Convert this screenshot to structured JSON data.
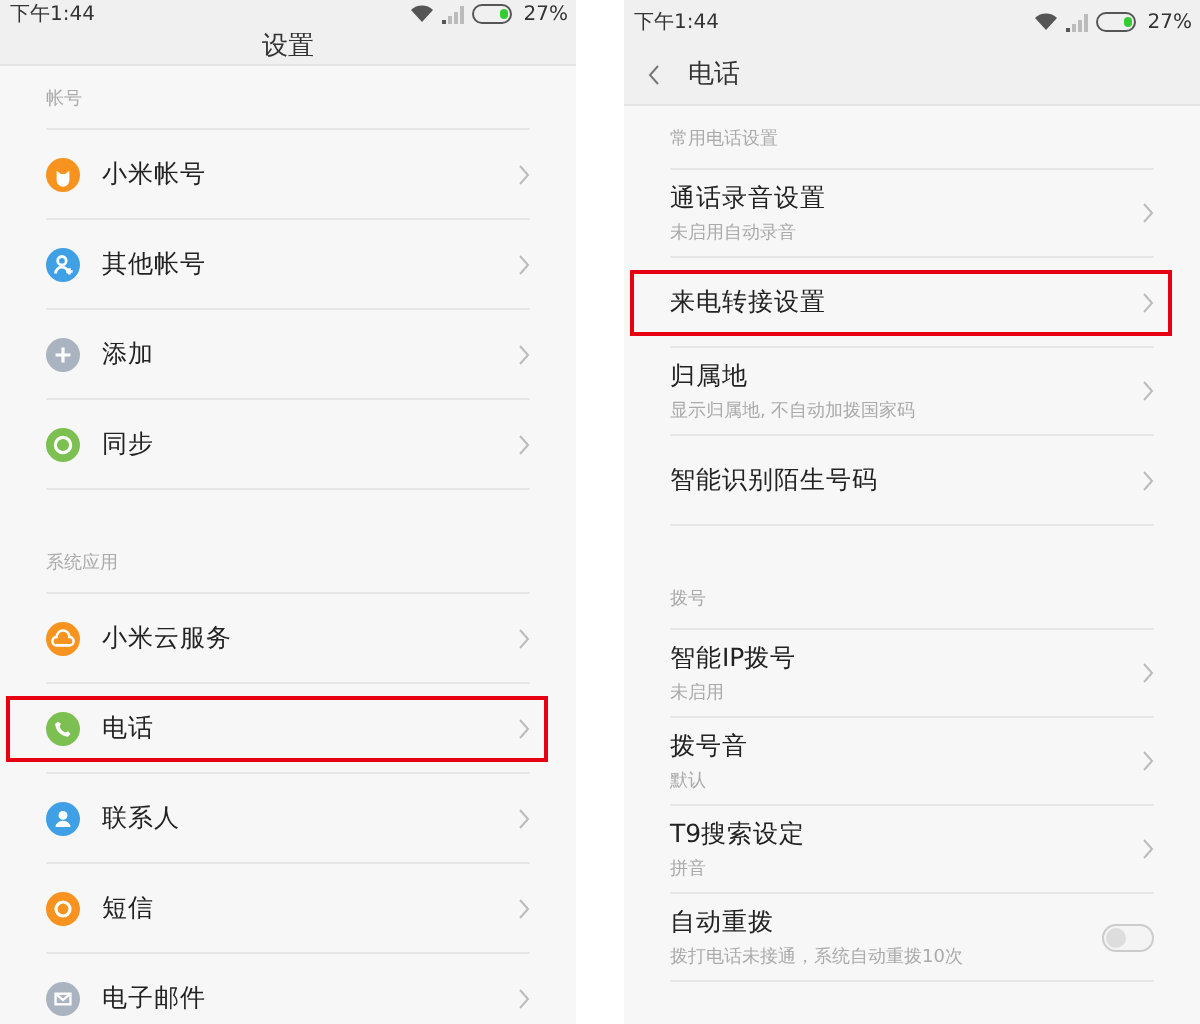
{
  "screens": [
    {
      "status_bar": {
        "time": "下午1:44",
        "battery": "27%"
      },
      "header": {
        "title": "设置",
        "back": false
      },
      "sections": [
        {
          "title": "帐号",
          "items": [
            {
              "label": "小米帐号",
              "kind": "mi",
              "color": "#f7931e",
              "highlighted": false
            },
            {
              "label": "其他帐号",
              "kind": "person",
              "color": "#3fa0e6",
              "highlighted": false
            },
            {
              "label": "添加",
              "kind": "plus",
              "color": "#a9b4c0",
              "highlighted": false
            },
            {
              "label": "同步",
              "kind": "sync",
              "color": "#7cc052",
              "highlighted": false
            }
          ]
        },
        {
          "title": "系统应用",
          "items": [
            {
              "label": "小米云服务",
              "kind": "cloud",
              "color": "#f7931e",
              "highlighted": false
            },
            {
              "label": "电话",
              "kind": "phone",
              "color": "#7cc052",
              "highlighted": true
            },
            {
              "label": "联系人",
              "kind": "contact",
              "color": "#3fa0e6",
              "highlighted": false
            },
            {
              "label": "短信",
              "kind": "message",
              "color": "#f7931e",
              "highlighted": false
            },
            {
              "label": "电子邮件",
              "kind": "mail",
              "color": "#a9b4c0",
              "highlighted": false
            }
          ]
        }
      ]
    },
    {
      "status_bar": {
        "time": "下午1:44",
        "battery": "27%"
      },
      "header": {
        "title": "电话",
        "back": true
      },
      "sections": [
        {
          "title": "常用电话设置",
          "items": [
            {
              "label": "通话录音设置",
              "subtitle": "未启用自动录音",
              "highlighted": false
            },
            {
              "label": "来电转接设置",
              "highlighted": true
            },
            {
              "label": "归属地",
              "subtitle": "显示归属地, 不自动加拨国家码",
              "highlighted": false
            },
            {
              "label": "智能识别陌生号码",
              "highlighted": false
            }
          ]
        },
        {
          "title": "拨号",
          "items": [
            {
              "label": "智能IP拨号",
              "subtitle": "未启用",
              "highlighted": false
            },
            {
              "label": "拨号音",
              "subtitle": "默认",
              "highlighted": false
            },
            {
              "label": "T9搜索设定",
              "subtitle": "拼音",
              "highlighted": false
            },
            {
              "label": "自动重拨",
              "subtitle": "拨打电话未接通，系统自动重拨10次",
              "toggle": true,
              "on": false,
              "highlighted": false
            }
          ]
        }
      ]
    }
  ]
}
